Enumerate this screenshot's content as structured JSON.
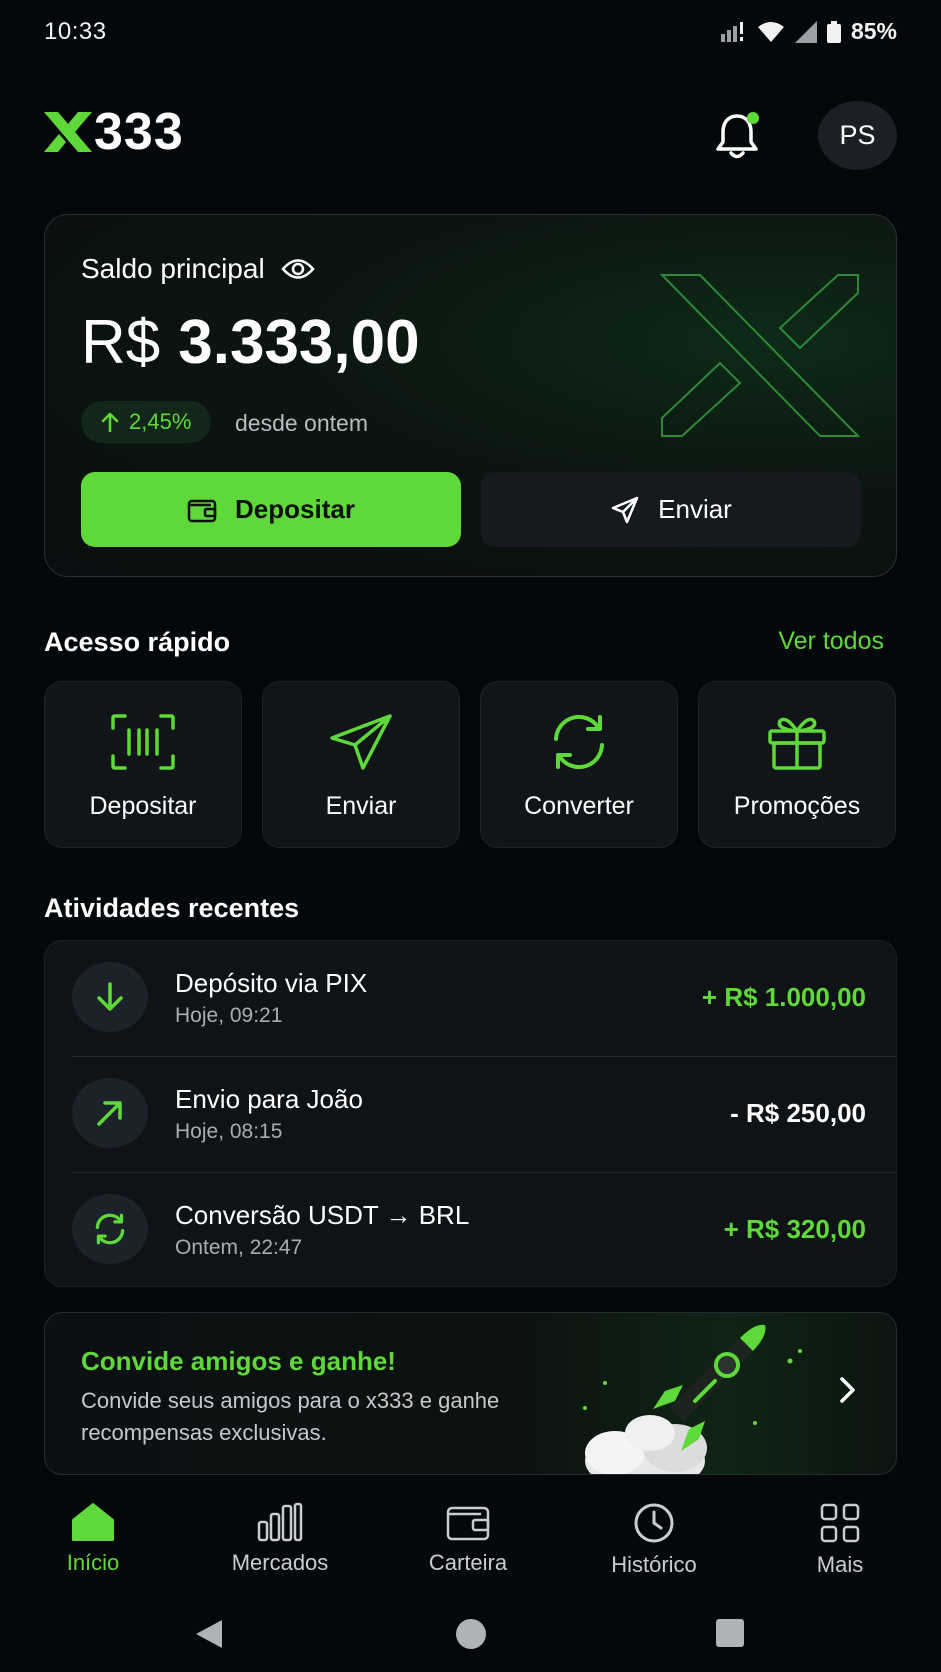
{
  "status_bar": {
    "time": "10:33",
    "battery": "85%"
  },
  "header": {
    "logo_text": "333",
    "avatar_initials": "PS"
  },
  "balance": {
    "label": "Saldo principal",
    "currency": "R$",
    "amount": "3.333,00",
    "change": "2,45%",
    "change_note": "desde ontem",
    "deposit_label": "Depositar",
    "send_label": "Enviar"
  },
  "quick_access": {
    "title": "Acesso rápido",
    "see_all": "Ver todos",
    "items": [
      {
        "label": "Depositar",
        "icon": "scan-icon"
      },
      {
        "label": "Enviar",
        "icon": "send-icon"
      },
      {
        "label": "Converter",
        "icon": "refresh-icon"
      },
      {
        "label": "Promoções",
        "icon": "gift-icon"
      }
    ]
  },
  "activities": {
    "title": "Atividades recentes",
    "items": [
      {
        "title": "Depósito via PIX",
        "subtitle": "Hoje, 09:21",
        "amount": "+ R$ 1.000,00",
        "icon": "arrow-down-icon"
      },
      {
        "title": "Envio para João",
        "subtitle": "Hoje, 08:15",
        "amount": "- R$ 250,00",
        "icon": "arrow-up-right-icon"
      },
      {
        "title": "Conversão USDT → BRL",
        "subtitle": "Ontem, 22:47",
        "amount": "+ R$ 320,00",
        "icon": "refresh-icon"
      }
    ]
  },
  "promo": {
    "title": "Convide amigos e ganhe!",
    "text": "Convide seus amigos para o x333 e ganhe recompensas exclusivas."
  },
  "bottom_nav": {
    "items": [
      {
        "label": "Início",
        "icon": "home-icon",
        "active": true
      },
      {
        "label": "Mercados",
        "icon": "bars-icon",
        "active": false
      },
      {
        "label": "Carteira",
        "icon": "wallet-icon",
        "active": false
      },
      {
        "label": "Histórico",
        "icon": "clock-icon",
        "active": false
      },
      {
        "label": "Mais",
        "icon": "grid-icon",
        "active": false
      }
    ]
  },
  "colors": {
    "accent": "#5fd939",
    "background": "#05080a",
    "card": "#0f1316"
  }
}
